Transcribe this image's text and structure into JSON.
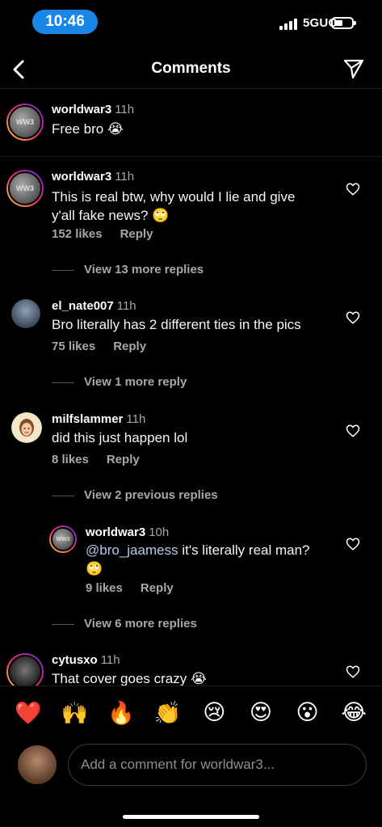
{
  "status_bar": {
    "time": "10:46",
    "network": "5GUC"
  },
  "header": {
    "title": "Comments",
    "back_icon": "chevron-left-icon",
    "send_icon": "paper-plane-icon"
  },
  "caption": {
    "username": "worldwar3",
    "time": "11h",
    "text": "Free bro 😭"
  },
  "comments": [
    {
      "username": "worldwar3",
      "time": "11h",
      "text": "This is real btw, why would I lie and give y'all fake news? 🙄",
      "likes": "152 likes",
      "reply": "Reply",
      "view_more": "View 13 more replies"
    },
    {
      "username": "el_nate007",
      "time": "11h",
      "text": "Bro literally has 2 different ties in the pics",
      "likes": "75 likes",
      "reply": "Reply",
      "view_more": "View 1 more reply"
    },
    {
      "username": "milfslammer",
      "time": "11h",
      "text": "did this just happen lol",
      "likes": "8 likes",
      "reply": "Reply",
      "view_more": "View 2 previous replies"
    },
    {
      "username": "worldwar3",
      "time": "10h",
      "mention": "@bro_jaamess",
      "text": " it's literally real man? 🙄",
      "likes": "9 likes",
      "reply": "Reply",
      "view_more": "View 6 more replies"
    },
    {
      "username": "cytusxo",
      "time": "11h",
      "text": "That cover goes crazy 😭"
    }
  ],
  "reactions": [
    "❤️",
    "🙌",
    "🔥",
    "👏",
    "😢",
    "😍",
    "😮",
    "😂"
  ],
  "composer": {
    "placeholder": "Add a comment for worldwar3..."
  }
}
